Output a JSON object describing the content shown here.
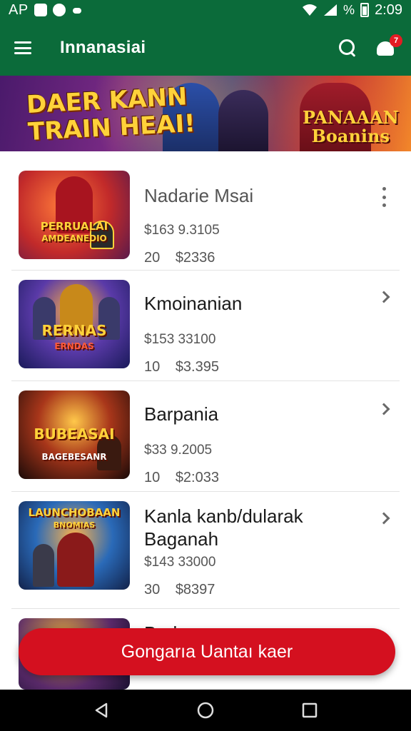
{
  "status_bar": {
    "left_text": "AP",
    "icons": [
      "app-d-icon",
      "heart-icon",
      "cloud-icon"
    ],
    "right_icons": [
      "wifi-icon",
      "signal-icon"
    ],
    "network_text": "%",
    "time": "2:09"
  },
  "app_bar": {
    "title": "Innanasiai",
    "notification_count": "7"
  },
  "banner": {
    "title_line1": "DAER KANN",
    "title_line2": "TRAIN HEAI!",
    "sub_line1": "PANAAAN",
    "sub_line2": "Boanins"
  },
  "items": [
    {
      "title": "Nadarie Msai",
      "price": "$163 9.3105",
      "qty": "20",
      "amount": "$2336",
      "thumb_label_1": "PERRUALAI",
      "thumb_label_2": "AMDEANEDIO",
      "action": "more"
    },
    {
      "title": "Kmoinanian",
      "price": "$153 33100",
      "qty": "10",
      "amount": "$3.395",
      "thumb_label_1": "RERNAS",
      "thumb_label_2": "ERNDAS",
      "action": "chevron"
    },
    {
      "title": "Barpania",
      "price": "$33 9.2005",
      "qty": "10",
      "amount": "$2:033",
      "thumb_label_1": "BUBEASAI",
      "thumb_label_2": "BAGEBESANR",
      "action": "chevron"
    },
    {
      "title": "Kanla kanb/dularak Baganah",
      "price": "$143 33000",
      "qty": "30",
      "amount": "$8397",
      "thumb_label_1": "LAUNCHOBAAN",
      "thumb_label_2": "BNOMIAS",
      "action": "chevron"
    },
    {
      "title": "Barla",
      "price": "",
      "qty": "",
      "amount": "",
      "thumb_label_1": "",
      "thumb_label_2": "",
      "action": ""
    }
  ],
  "cta": {
    "label": "Gongarıa Uantaı kaer"
  },
  "nav": {
    "back": "back-icon",
    "home": "home-icon",
    "recent": "recent-apps-icon"
  },
  "colors": {
    "primary": "#0b6b3a",
    "accent": "#d4101f",
    "badge": "#e31b23"
  }
}
